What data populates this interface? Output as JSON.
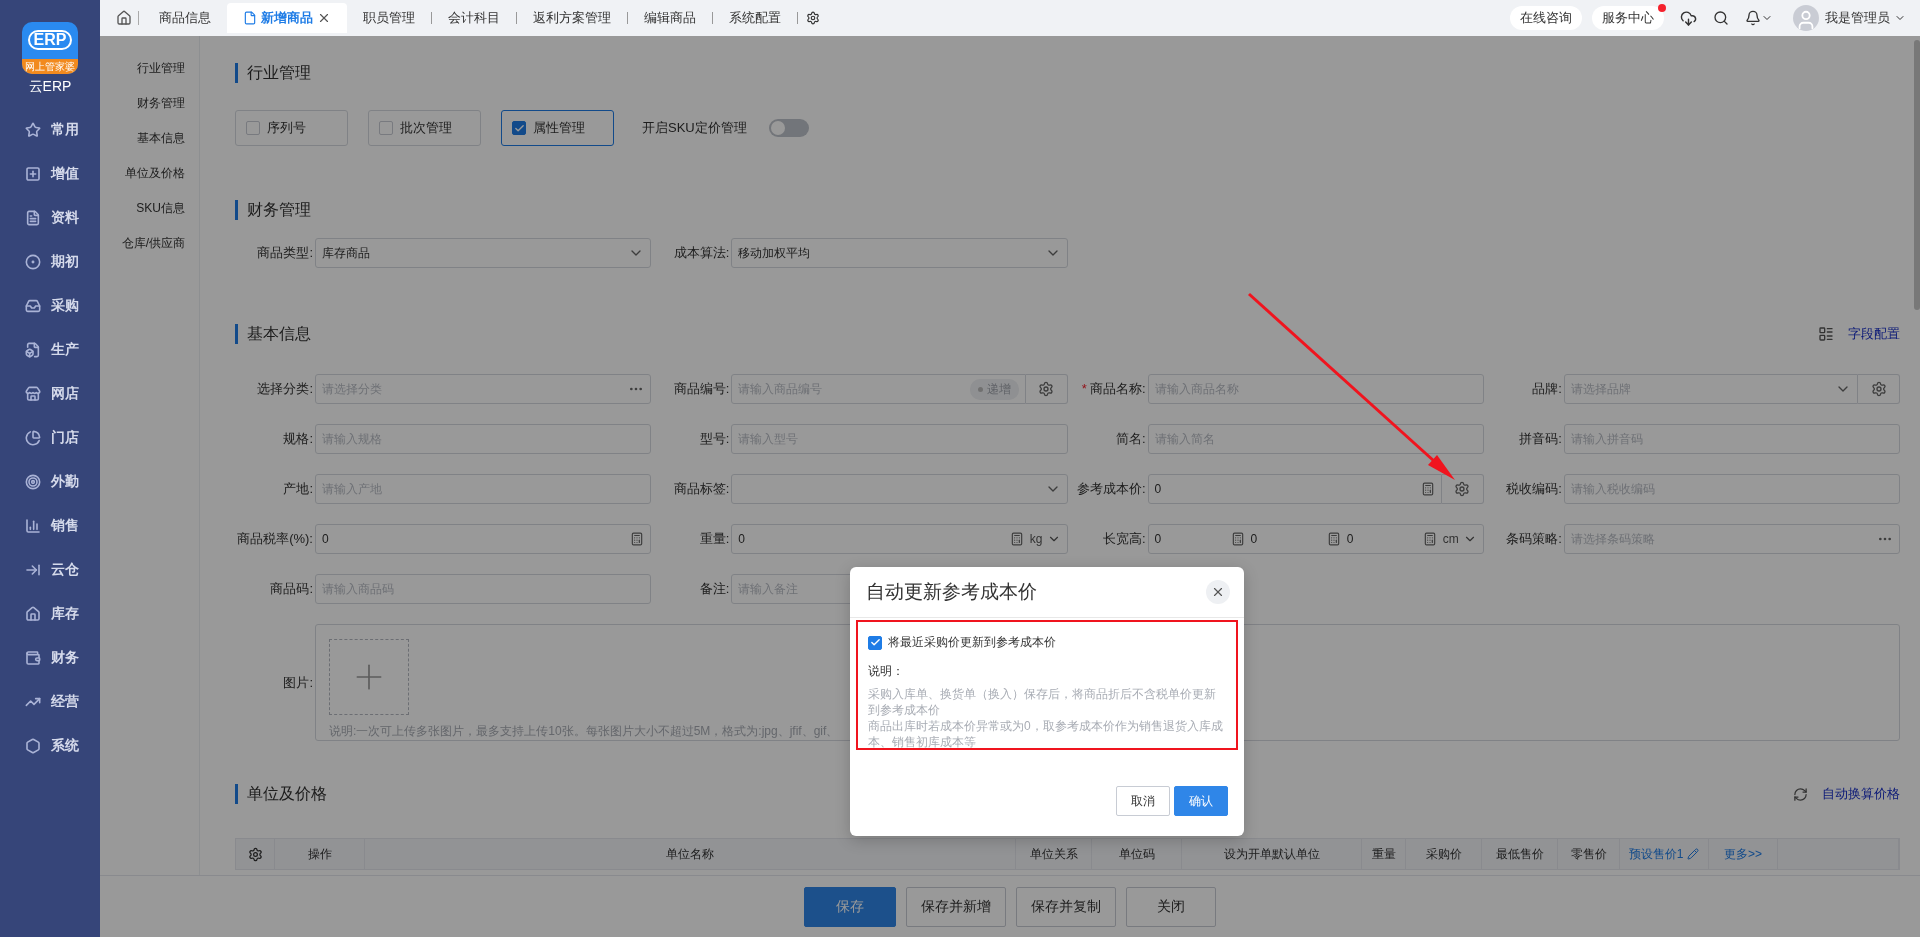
{
  "sidebar": {
    "logo_mark": "ERP",
    "logo_badge": "网上管家婆",
    "logo_caption": "云ERP",
    "items": [
      {
        "label": "常用"
      },
      {
        "label": "增值"
      },
      {
        "label": "资料"
      },
      {
        "label": "期初"
      },
      {
        "label": "采购"
      },
      {
        "label": "生产"
      },
      {
        "label": "网店"
      },
      {
        "label": "门店"
      },
      {
        "label": "外勤"
      },
      {
        "label": "销售"
      },
      {
        "label": "云仓"
      },
      {
        "label": "库存"
      },
      {
        "label": "财务"
      },
      {
        "label": "经营"
      },
      {
        "label": "系统"
      }
    ]
  },
  "top_bar": {
    "tabs": [
      {
        "label": "商品信息",
        "selected": false
      },
      {
        "label": "新增商品",
        "selected": true
      },
      {
        "label": "职员管理",
        "selected": false
      },
      {
        "label": "会计科目",
        "selected": false
      },
      {
        "label": "返利方案管理",
        "selected": false
      },
      {
        "label": "编辑商品",
        "selected": false
      },
      {
        "label": "系统配置",
        "selected": false
      }
    ],
    "consult": "在线咨询",
    "service": {
      "label": "服务中心",
      "has_badge": true
    },
    "user": "我是管理员"
  },
  "anchors": [
    "行业管理",
    "财务管理",
    "基本信息",
    "单位及价格",
    "SKU信息",
    "仓库/供应商"
  ],
  "industry": {
    "title": "行业管理",
    "options": [
      {
        "label": "序列号",
        "checked": false
      },
      {
        "label": "批次管理",
        "checked": false
      },
      {
        "label": "属性管理",
        "checked": true
      }
    ],
    "toggle": {
      "label": "开启SKU定价管理",
      "on": false
    }
  },
  "finance": {
    "title": "财务管理",
    "fields": [
      {
        "label": "商品类型:",
        "value": "库存商品"
      },
      {
        "label": "成本算法:",
        "value": "移动加权平均"
      }
    ]
  },
  "basic": {
    "title": "基本信息",
    "config_link": "字段配置",
    "fields": [
      {
        "label": "选择分类:",
        "kind": "picker",
        "placeholder": "请选择分类",
        "gear": false
      },
      {
        "label": "商品编号:",
        "kind": "text",
        "placeholder": "请输入商品编号",
        "tag": "递增",
        "gear": true
      },
      {
        "label": "商品名称:",
        "required_mark": "*",
        "kind": "text",
        "placeholder": "请输入商品名称",
        "gear": false
      },
      {
        "label": "品牌:",
        "kind": "select",
        "placeholder": "请选择品牌",
        "gear": true
      },
      {
        "label": "规格:",
        "kind": "text",
        "placeholder": "请输入规格",
        "gear": false
      },
      {
        "label": "型号:",
        "kind": "text",
        "placeholder": "请输入型号",
        "gear": false
      },
      {
        "label": "简名:",
        "kind": "text",
        "placeholder": "请输入简名",
        "gear": false
      },
      {
        "label": "拼音码:",
        "kind": "text",
        "placeholder": "请输入拼音码",
        "gear": false
      },
      {
        "label": "产地:",
        "kind": "text",
        "placeholder": "请输入产地",
        "gear": false
      },
      {
        "label": "商品标签:",
        "kind": "select",
        "gear": false
      },
      {
        "label": "参考成本价:",
        "kind": "number",
        "value": "0",
        "gear": true
      },
      {
        "label": "税收编码:",
        "kind": "text",
        "placeholder": "请输入税收编码",
        "gear": false
      },
      {
        "label": "商品税率(%):",
        "kind": "number",
        "value": "0",
        "gear": false
      },
      {
        "label": "重量:",
        "kind": "number",
        "value": "0",
        "unit": "kg",
        "gear": false
      },
      {
        "label": "长宽高:",
        "kind": "dims",
        "values": [
          "0",
          "0",
          "0"
        ],
        "unit": "cm",
        "gear": false
      },
      {
        "label": "条码策略:",
        "kind": "picker",
        "placeholder": "请选择条码策略",
        "gear": false
      },
      {
        "label": "商品码:",
        "kind": "text",
        "placeholder": "请输入商品码",
        "gear": false
      },
      {
        "label": "备注:",
        "kind": "text",
        "placeholder": "请输入备注",
        "gear": false
      }
    ],
    "image": {
      "label": "图片:",
      "note": "说明:一次可上传多张图片，最多支持上传10张。每张图片大小不超过5M，格式为:jpg、jfif、gif、"
    }
  },
  "units": {
    "title": "单位及价格",
    "auto_link": "自动换算价格",
    "columns": [
      {
        "label": "操作",
        "kind": "text"
      },
      {
        "label": "单位名称",
        "kind": "text"
      },
      {
        "label": "单位关系",
        "kind": "text"
      },
      {
        "label": "单位码",
        "kind": "text"
      },
      {
        "label": "设为开单默认单位",
        "kind": "text"
      },
      {
        "label": "重量",
        "kind": "text"
      },
      {
        "label": "采购价",
        "kind": "text"
      },
      {
        "label": "最低售价",
        "kind": "text"
      },
      {
        "label": "零售价",
        "kind": "text"
      },
      {
        "label": "预设售价1",
        "kind": "edit_link"
      },
      {
        "label": "更多>>",
        "kind": "link"
      }
    ]
  },
  "footer_buttons": [
    {
      "label": "保存",
      "primary": true
    },
    {
      "label": "保存并新增",
      "primary": false
    },
    {
      "label": "保存并复制",
      "primary": false
    },
    {
      "label": "关闭",
      "primary": false
    }
  ],
  "dialog": {
    "title": "自动更新参考成本价",
    "option": {
      "label": "将最近采购价更新到参考成本价",
      "checked": true
    },
    "note_title": "说明：",
    "notes": [
      "采购入库单、换货单（换入）保存后，将商品折后不含税单价更新到参考成本价",
      "商品出库时若成本价异常或为0，取参考成本价作为销售退货入库成本、销售初库成本等"
    ],
    "buttons": [
      {
        "label": "取消",
        "primary": false
      },
      {
        "label": "确认",
        "primary": true
      }
    ]
  }
}
